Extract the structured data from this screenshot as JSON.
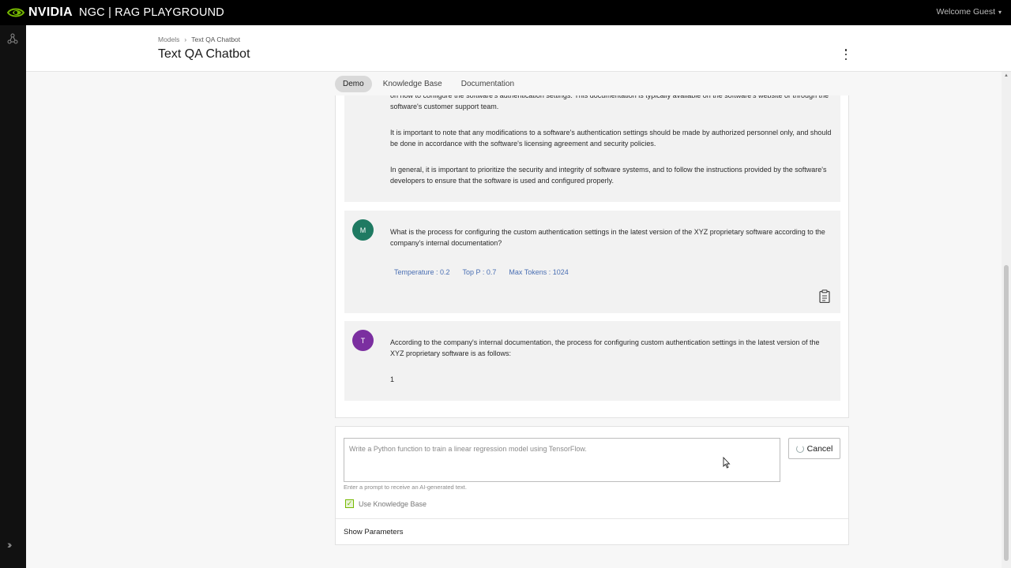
{
  "app": {
    "brand": "NVIDIA",
    "title": "NGC | RAG PLAYGROUND",
    "welcome": "Welcome Guest"
  },
  "header": {
    "breadcrumbs": [
      "Models",
      "Text QA Chatbot"
    ],
    "page_title": "Text QA Chatbot"
  },
  "tabs": [
    {
      "label": "Demo",
      "active": true
    },
    {
      "label": "Knowledge Base",
      "active": false
    },
    {
      "label": "Documentation",
      "active": false
    }
  ],
  "chat": {
    "messages": [
      {
        "role": "assistant-partial",
        "paragraphs": [
          "on how to configure the software's authentication settings. This documentation is typically available on the software's website or through the software's customer support team.",
          "It is important to note that any modifications to a software's authentication settings should be made by authorized personnel only, and should be done in accordance with the software's licensing agreement and security policies.",
          "In general, it is important to prioritize the security and integrity of software systems, and to follow the instructions provided by the software's developers to ensure that the software is used and configured properly."
        ]
      },
      {
        "role": "user",
        "avatar": "M",
        "avatar_color": "#1f7a62",
        "text": "What is the process for configuring the custom authentication settings in the latest version of the XYZ proprietary software according to the company's internal documentation?",
        "params": {
          "temperature": "Temperature : 0.2",
          "top_p": "Top P : 0.7",
          "max_tokens": "Max Tokens : 1024"
        }
      },
      {
        "role": "assistant",
        "avatar": "T",
        "avatar_color": "#7b2fa0",
        "text": "According to the company's internal documentation, the process for configuring custom authentication settings in the latest version of the XYZ proprietary software is as follows:",
        "text2": "1"
      }
    ]
  },
  "input": {
    "placeholder": "Write a Python function to train a linear regression model using TensorFlow.",
    "hint": "Enter a prompt to receive an AI-generated text.",
    "cancel_label": "Cancel",
    "use_kb_label": "Use Knowledge Base",
    "use_kb_checked": true,
    "show_params_label": "Show Parameters"
  },
  "colors": {
    "nvidia_green": "#76b900",
    "param_blue": "#4a6fb3"
  }
}
